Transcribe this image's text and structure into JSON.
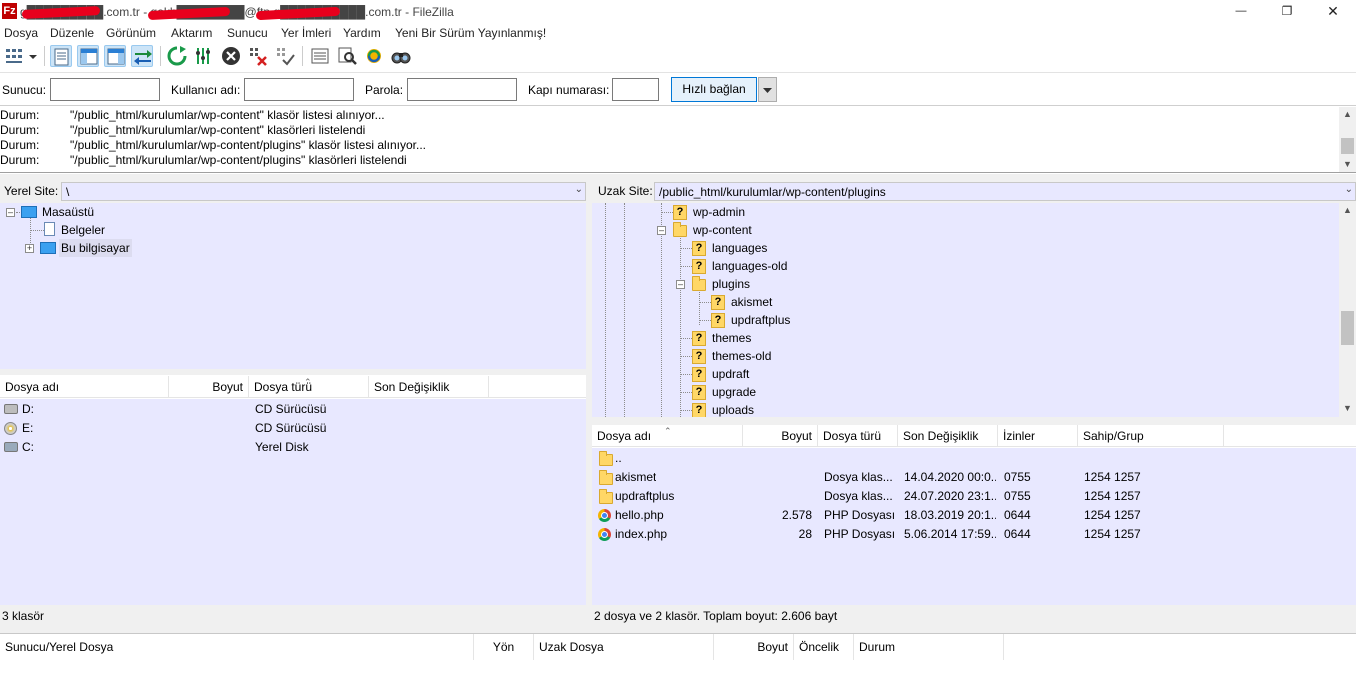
{
  "window": {
    "title": "g█████████.com.tr - gokh████████@ftp.g██████████.com.tr - FileZilla",
    "app_icon_text": "Fz",
    "minimize": "—",
    "restore": "❐",
    "close": "✕"
  },
  "menu": {
    "items": [
      "Dosya",
      "Düzenle",
      "Görünüm",
      "Aktarım",
      "Sunucu",
      "Yer İmleri",
      "Yardım",
      "Yeni Bir Sürüm Yayınlanmış!"
    ]
  },
  "quickconnect": {
    "host_label": "Sunucu:",
    "host_value": "",
    "user_label": "Kullanıcı adı:",
    "user_value": "",
    "pass_label": "Parola:",
    "pass_value": "",
    "port_label": "Kapı numarası:",
    "port_value": "",
    "connect_label": "Hızlı bağlan"
  },
  "log": {
    "lines": [
      {
        "status": "Durum:",
        "message": "\"/public_html/kurulumlar/wp-content\" klasör listesi alınıyor..."
      },
      {
        "status": "Durum:",
        "message": "\"/public_html/kurulumlar/wp-content\" klasörleri listelendi"
      },
      {
        "status": "Durum:",
        "message": "\"/public_html/kurulumlar/wp-content/plugins\" klasör listesi alınıyor..."
      },
      {
        "status": "Durum:",
        "message": "\"/public_html/kurulumlar/wp-content/plugins\" klasörleri listelendi"
      }
    ]
  },
  "local": {
    "site_label": "Yerel Site:",
    "path": "\\",
    "tree": [
      {
        "label": "Masaüstü",
        "icon": "desktop-icon"
      },
      {
        "label": "Belgeler",
        "icon": "documents-icon"
      },
      {
        "label": "Bu bilgisayar",
        "icon": "computer-icon"
      }
    ],
    "columns": [
      "Dosya adı",
      "Boyut",
      "Dosya türü",
      "Son Değişiklik"
    ],
    "rows": [
      {
        "name": "D:",
        "size": "",
        "type": "CD Sürücüsü",
        "modified": "",
        "icon": "drive-icon"
      },
      {
        "name": "E:",
        "size": "",
        "type": "CD Sürücüsü",
        "modified": "",
        "icon": "cd-icon"
      },
      {
        "name": "C:",
        "size": "",
        "type": "Yerel Disk",
        "modified": "",
        "icon": "disk-icon"
      }
    ],
    "status": "3 klasör"
  },
  "remote": {
    "site_label": "Uzak Site:",
    "path": "/public_html/kurulumlar/wp-content/plugins",
    "tree": [
      {
        "label": "wp-admin",
        "kind": "unknown"
      },
      {
        "label": "wp-content",
        "kind": "folder"
      },
      {
        "label": "languages",
        "kind": "unknown"
      },
      {
        "label": "languages-old",
        "kind": "unknown"
      },
      {
        "label": "plugins",
        "kind": "folder"
      },
      {
        "label": "akismet",
        "kind": "unknown"
      },
      {
        "label": "updraftplus",
        "kind": "unknown"
      },
      {
        "label": "themes",
        "kind": "unknown"
      },
      {
        "label": "themes-old",
        "kind": "unknown"
      },
      {
        "label": "updraft",
        "kind": "unknown"
      },
      {
        "label": "upgrade",
        "kind": "unknown"
      },
      {
        "label": "uploads",
        "kind": "unknown"
      }
    ],
    "columns": [
      "Dosya adı",
      "Boyut",
      "Dosya türü",
      "Son Değişiklik",
      "İzinler",
      "Sahip/Grup"
    ],
    "rows": [
      {
        "name": "..",
        "size": "",
        "type": "",
        "modified": "",
        "perms": "",
        "owner": "",
        "icon": "folder-icon"
      },
      {
        "name": "akismet",
        "size": "",
        "type": "Dosya klas...",
        "modified": "14.04.2020 00:0...",
        "perms": "0755",
        "owner": "1254 1257",
        "icon": "folder-icon"
      },
      {
        "name": "updraftplus",
        "size": "",
        "type": "Dosya klas...",
        "modified": "24.07.2020 23:1...",
        "perms": "0755",
        "owner": "1254 1257",
        "icon": "folder-icon"
      },
      {
        "name": "hello.php",
        "size": "2.578",
        "type": "PHP Dosyası",
        "modified": "18.03.2019 20:1...",
        "perms": "0644",
        "owner": "1254 1257",
        "icon": "php-file-icon"
      },
      {
        "name": "index.php",
        "size": "28",
        "type": "PHP Dosyası",
        "modified": "5.06.2014 17:59...",
        "perms": "0644",
        "owner": "1254 1257",
        "icon": "php-file-icon"
      }
    ],
    "status": "2 dosya ve 2 klasör. Toplam boyut: 2.606 bayt"
  },
  "queue": {
    "columns": [
      "Sunucu/Yerel Dosya",
      "Yön",
      "Uzak Dosya",
      "Boyut",
      "Öncelik",
      "Durum"
    ]
  },
  "colors": {
    "pane_background": "#e8e8ff",
    "redaction": "#e8001c",
    "app_icon": "#bf0000"
  }
}
